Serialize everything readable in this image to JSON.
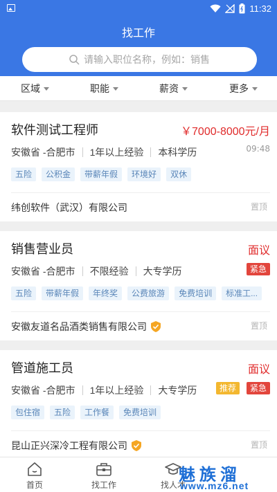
{
  "status": {
    "time": "11:32"
  },
  "header": {
    "title": "找工作"
  },
  "search": {
    "placeholder": "请输入职位名称，例如：销售"
  },
  "filters": [
    "区域",
    "职能",
    "薪资",
    "更多"
  ],
  "jobs": [
    {
      "title": "软件测试工程师",
      "salary": "￥7000-8000元/月",
      "location": "安徽省 -合肥市",
      "experience": "1年以上经验",
      "education": "本科学历",
      "time": "09:48",
      "tags": [
        "五险",
        "公积金",
        "带薪年假",
        "环境好",
        "双休"
      ],
      "company": "纬创软件（武汉）有限公司",
      "pin": "置顶"
    },
    {
      "title": "销售营业员",
      "salary": "面议",
      "location": "安徽省 -合肥市",
      "experience": "不限经验",
      "education": "大专学历",
      "badges": [
        "紧急"
      ],
      "tags": [
        "五险",
        "带薪年假",
        "年终奖",
        "公费旅游",
        "免费培训",
        "标准工..."
      ],
      "company": "安徽友道名品酒类销售有限公司",
      "pin": "置顶"
    },
    {
      "title": "管道施工员",
      "salary": "面议",
      "location": "安徽省 -合肥市",
      "experience": "1年以上经验",
      "education": "大专学历",
      "badges": [
        "推荐",
        "紧急"
      ],
      "tags": [
        "包住宿",
        "五险",
        "工作餐",
        "免费培训"
      ],
      "company": "昆山正兴深冷工程有限公司",
      "pin": "置顶"
    }
  ],
  "tabbar": [
    "首页",
    "找工作",
    "找人才"
  ],
  "watermark": {
    "title": "魅族溜",
    "url": "www.mz6.net"
  },
  "colors": {
    "primary": "#3a77e4",
    "salary": "#e02b2b",
    "urgent": "#e2453c",
    "recommend": "#f3b72f",
    "tag_bg": "#eaf3fb",
    "tag_text": "#5a86b8"
  }
}
